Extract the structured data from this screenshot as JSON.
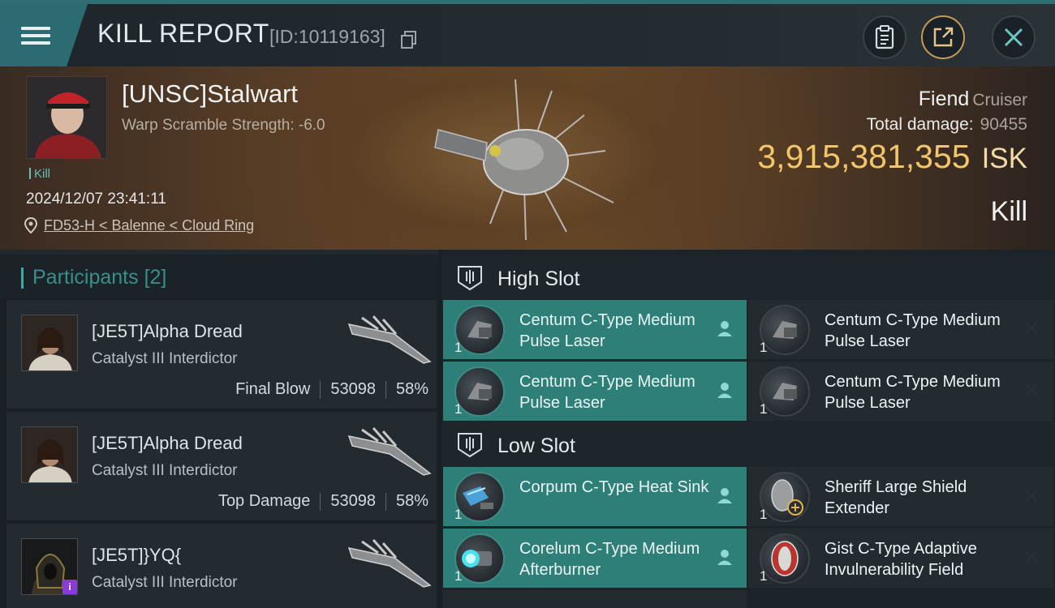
{
  "header": {
    "title": "KILL REPORT",
    "report_id": "[ID:10119163]"
  },
  "victim": {
    "name": "[UNSC]Stalwart",
    "warp_scramble": "Warp Scramble Strength: -6.0",
    "tag": "Kill",
    "datetime": "2024/12/07 23:41:11",
    "location": "FD53-H < Balenne < Cloud Ring",
    "ship_name": "Fiend",
    "ship_class": "Cruiser",
    "total_damage_label": "Total damage:",
    "total_damage": "90455",
    "isk_value": "3,915,381,355",
    "isk_unit": "ISK",
    "result": "Kill"
  },
  "participants": {
    "title": "Participants",
    "count": "[2]",
    "items": [
      {
        "name": "[JE5T]Alpha Dread",
        "ship": "Catalyst III Interdictor",
        "role": "Final Blow",
        "damage": "53098",
        "percent": "58%"
      },
      {
        "name": "[JE5T]Alpha Dread",
        "ship": "Catalyst III Interdictor",
        "role": "Top Damage",
        "damage": "53098",
        "percent": "58%"
      },
      {
        "name": "[JE5T]}YQ{",
        "ship": "Catalyst III Interdictor",
        "badge": "i"
      }
    ]
  },
  "modules": {
    "high_slot_label": "High Slot",
    "low_slot_label": "Low Slot",
    "high": [
      {
        "name": "Centum C-Type Medium Pulse Laser",
        "qty": "1",
        "state": "dropped"
      },
      {
        "name": "Centum C-Type Medium Pulse Laser",
        "qty": "1",
        "state": "destroyed"
      },
      {
        "name": "Centum C-Type Medium Pulse Laser",
        "qty": "1",
        "state": "dropped"
      },
      {
        "name": "Centum C-Type Medium Pulse Laser",
        "qty": "1",
        "state": "destroyed"
      }
    ],
    "low": [
      {
        "name": "Corpum C-Type Heat Sink",
        "qty": "1",
        "state": "dropped"
      },
      {
        "name": "Sheriff Large Shield Extender",
        "qty": "1",
        "state": "destroyed"
      },
      {
        "name": "Corelum C-Type Medium Afterburner",
        "qty": "1",
        "state": "dropped"
      },
      {
        "name": "Gist C-Type Adaptive Invulnerability Field",
        "qty": "1",
        "state": "destroyed"
      }
    ]
  },
  "colors": {
    "accent": "#2f7f79",
    "isk": "#f2c56a",
    "share_ring": "#c49a55"
  },
  "icons": [
    "menu-icon",
    "copy-icon",
    "clipboard-icon",
    "share-icon",
    "close-icon",
    "location-pin-icon",
    "high-slot-icon",
    "low-slot-icon",
    "pilot-icon",
    "destroyed-x-icon"
  ]
}
